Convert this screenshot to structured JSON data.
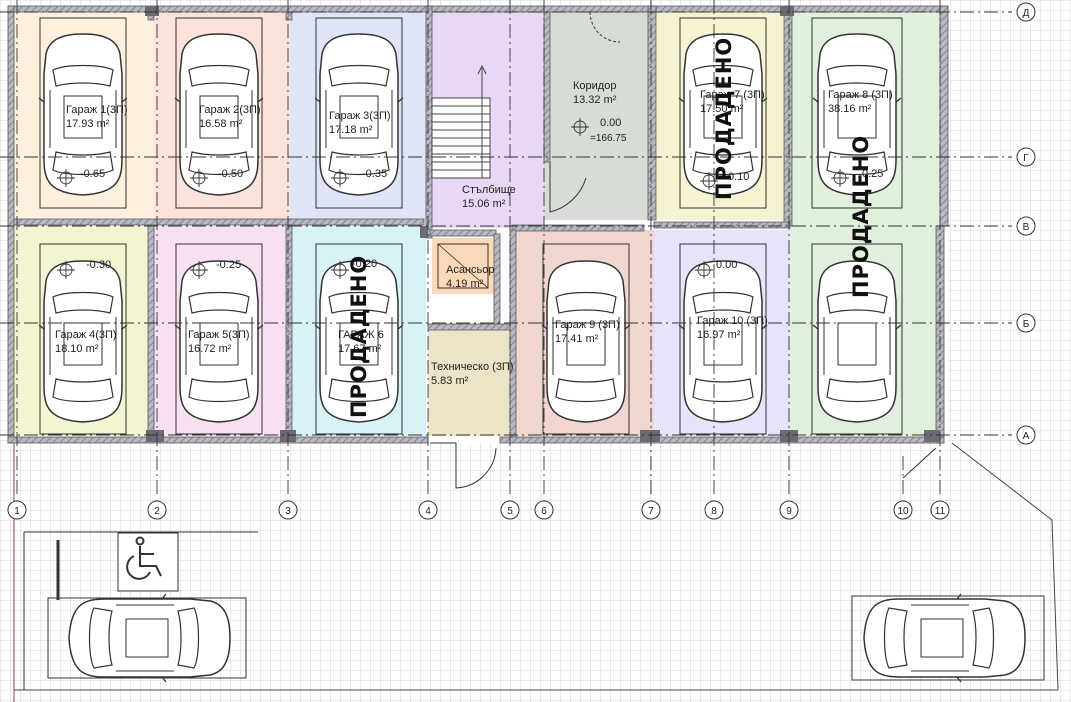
{
  "rooms": [
    {
      "id": "g1",
      "name": "Гараж 1(3П)",
      "area": "17.93 m²",
      "level": "-0.65",
      "fill": "#fdf0dc"
    },
    {
      "id": "g2",
      "name": "Гараж 2(3П)",
      "area": "16.58 m²",
      "level": "-0.50",
      "fill": "#fbe2da"
    },
    {
      "id": "g3",
      "name": "Гараж 3(3П)",
      "area": "17.18 m²",
      "level": "-0.35",
      "fill": "#dfe4f6"
    },
    {
      "id": "stair",
      "name": "Стълбище",
      "area": "15.06 m²",
      "fill": "#e8d8f6"
    },
    {
      "id": "corr",
      "name": "Коридор",
      "area": "13.32 m²",
      "level": "0.00",
      "level2": "=166.75",
      "fill": "#d8dcd6"
    },
    {
      "id": "g7",
      "name": "Гараж 7 (3П)",
      "area": "17.50 m²",
      "level": "0.10",
      "fill": "#f6f3d2"
    },
    {
      "id": "g8",
      "name": "Гараж 8 (3П)",
      "area": "38.16 m²",
      "level": "0.25",
      "fill": "#e1f0dc"
    },
    {
      "id": "g4",
      "name": "Гараж 4(3П)",
      "area": "18.10 m²",
      "level": "-0.30",
      "fill": "#f2f5cf"
    },
    {
      "id": "g5",
      "name": "Гараж 5(3П)",
      "area": "16.72 m²",
      "level": "-0.25",
      "fill": "#f6e0f2"
    },
    {
      "id": "g6",
      "name": "ГАРАЖ 6",
      "area": "17.67 m²",
      "level": "-0.20",
      "fill": "#d8f3f6"
    },
    {
      "id": "elev",
      "name": "Асансьор",
      "area": "4.19 m²",
      "fill": "#fbd8b8"
    },
    {
      "id": "tech",
      "name": "Техническо (3П)",
      "area": "5.83 m²",
      "fill": "#ece4c6"
    },
    {
      "id": "g9",
      "name": "Гараж 9 (3П)",
      "area": "17.41 m²",
      "fill": "#f1d6cf"
    },
    {
      "id": "g10",
      "name": "Гараж 10 (3П)",
      "area": "16.97 m²",
      "level": "0.00",
      "fill": "#e6e4fa"
    }
  ],
  "sold_label": "ПРОДАДЕНО",
  "axes": {
    "rows": [
      "Д",
      "Г",
      "В",
      "Б",
      "А"
    ],
    "cols": [
      "1",
      "2",
      "3",
      "4",
      "5",
      "6",
      "7",
      "8",
      "9",
      "10",
      "11"
    ]
  },
  "icons": [
    "car-icon",
    "wheelchair-icon",
    "level-marker-icon"
  ],
  "colors": {
    "wall": "#8c8c96",
    "grid": "#c6c8cc",
    "lines": "#333333"
  }
}
